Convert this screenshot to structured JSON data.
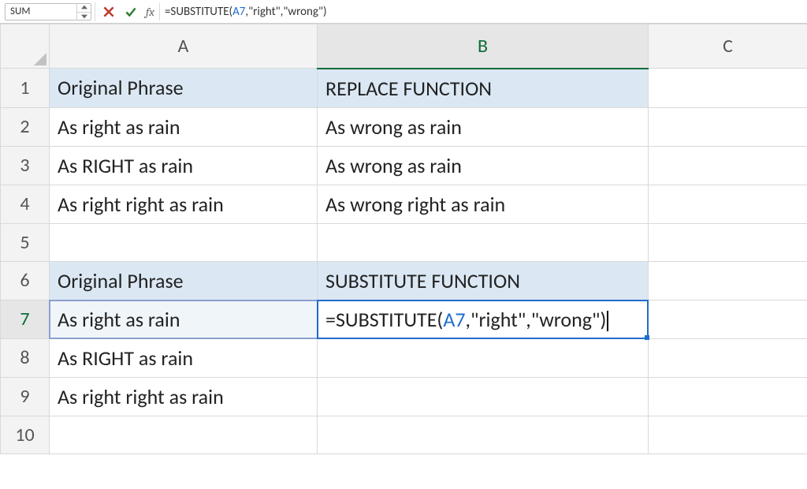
{
  "formula_bar": {
    "namebox_value": "SUM",
    "cancel_label": "Cancel",
    "enter_label": "Enter",
    "fx_label": "fx",
    "formula_prefix": "=SUBSTITUTE(",
    "formula_ref": "A7",
    "formula_suffix": ",\"right\",\"wrong\")"
  },
  "columns": {
    "A": "A",
    "B": "B",
    "C": "C"
  },
  "row_labels": [
    "1",
    "2",
    "3",
    "4",
    "5",
    "6",
    "7",
    "8",
    "9",
    "10"
  ],
  "cells": {
    "A1": "Original Phrase",
    "B1": "REPLACE FUNCTION",
    "A2": "As right as rain",
    "B2": "As wrong as rain",
    "A3": "As RIGHT as rain",
    "B3": "As wrong as rain",
    "A4": "As right right as rain",
    "B4": "As wrong right as rain",
    "A5": "",
    "B5": "",
    "A6": "Original Phrase",
    "B6": "SUBSTITUTE FUNCTION",
    "A7": "As right as rain",
    "B7_prefix": "=SUBSTITUTE(",
    "B7_ref": "A7",
    "B7_suffix": ",\"right\",\"wrong\")",
    "A8": "As RIGHT as rain",
    "B8": "",
    "A9": "As right right as rain",
    "B9": "",
    "A10": "",
    "B10": ""
  },
  "active": {
    "cell": "B7",
    "col": "B"
  }
}
